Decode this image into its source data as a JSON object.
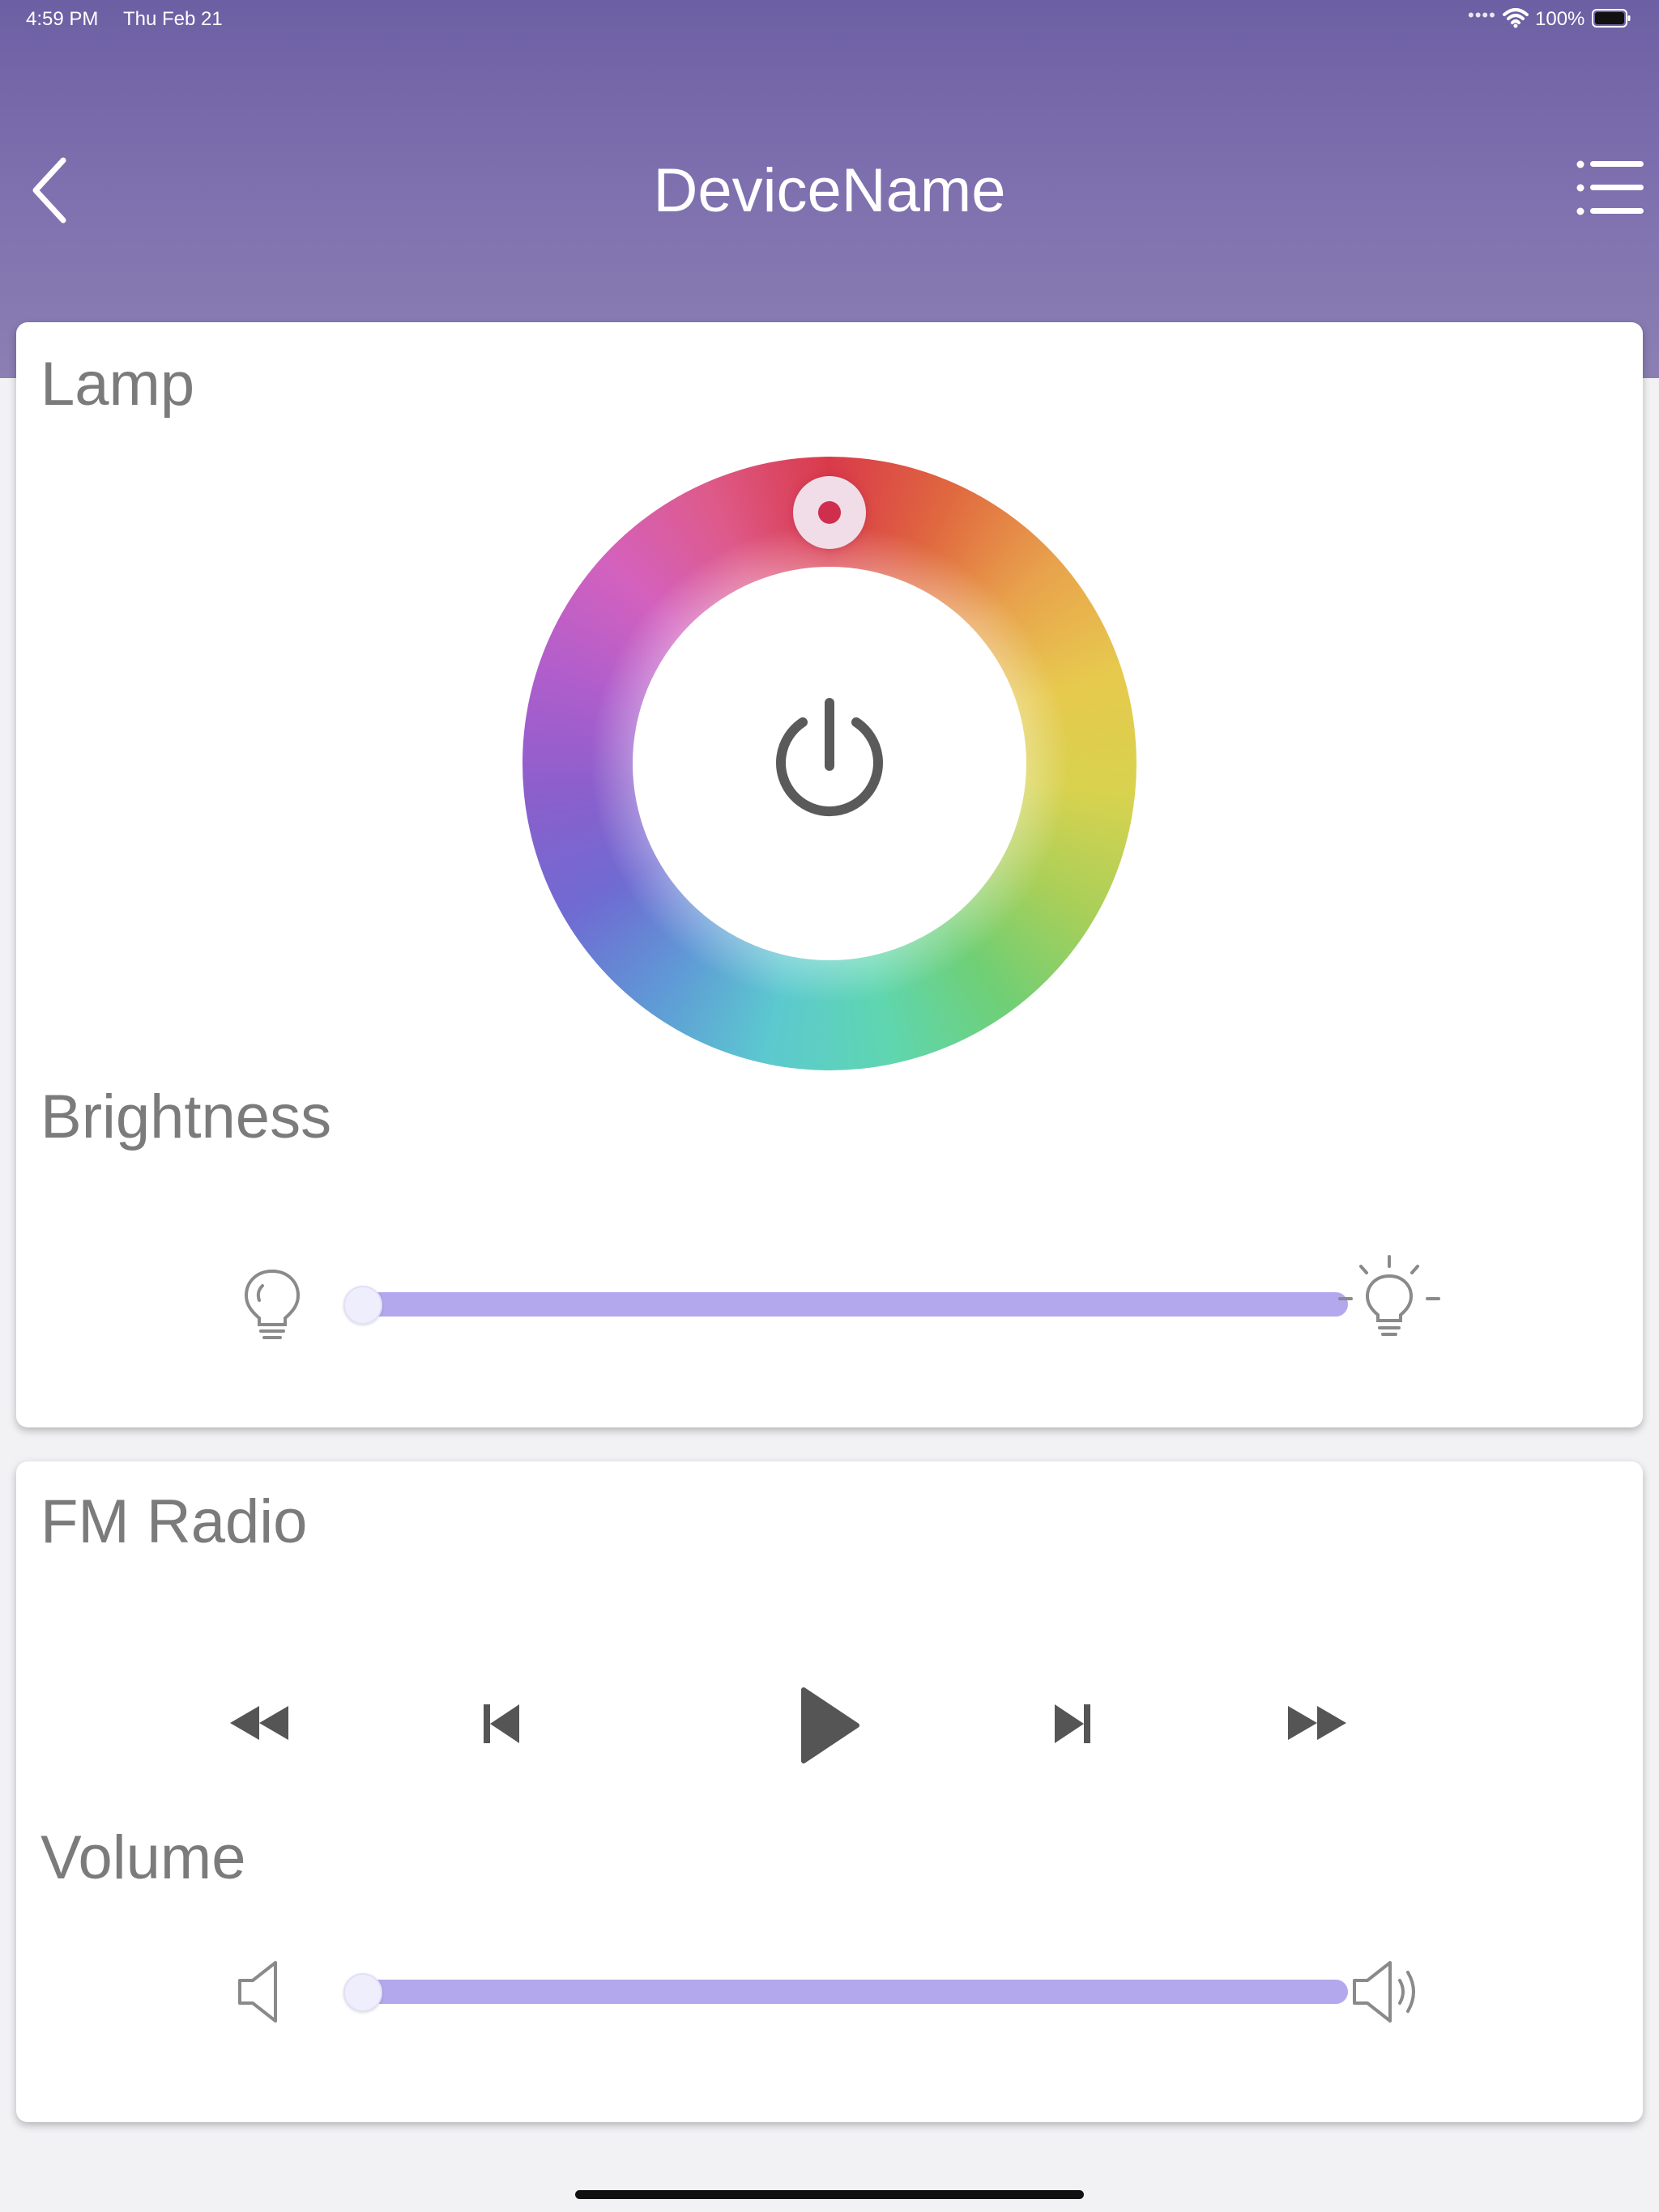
{
  "status_bar": {
    "time": "4:59 PM",
    "date": "Thu Feb 21",
    "signal_dots": "••••",
    "battery_percent": "100%",
    "wifi_icon": "wifi-icon",
    "battery_icon": "battery-full-icon"
  },
  "nav": {
    "title": "DeviceName",
    "back_icon": "chevron-left-icon",
    "menu_icon": "list-menu-icon"
  },
  "colors": {
    "header_top": "#6c5fa3",
    "header_bottom": "#8b7fb3",
    "slider_track": "#b3a7ee",
    "icon_gray": "#5a5a5a",
    "label_gray": "#7b7b7b",
    "selected_color": "#cf2f4d"
  },
  "lamp": {
    "title": "Lamp",
    "power_icon": "power-icon",
    "color_wheel": {
      "selected_hue_deg": 0
    },
    "brightness": {
      "label": "Brightness",
      "value": 0,
      "min_icon": "lightbulb-off-icon",
      "max_icon": "lightbulb-on-icon"
    }
  },
  "radio": {
    "title": "FM Radio",
    "controls": [
      {
        "name": "rewind",
        "icon": "rewind-icon"
      },
      {
        "name": "previous",
        "icon": "skip-previous-icon"
      },
      {
        "name": "play",
        "icon": "play-icon"
      },
      {
        "name": "next",
        "icon": "skip-next-icon"
      },
      {
        "name": "fast_forward",
        "icon": "fast-forward-icon"
      }
    ],
    "volume": {
      "label": "Volume",
      "value": 0,
      "min_icon": "speaker-mute-icon",
      "max_icon": "speaker-loud-icon"
    }
  }
}
